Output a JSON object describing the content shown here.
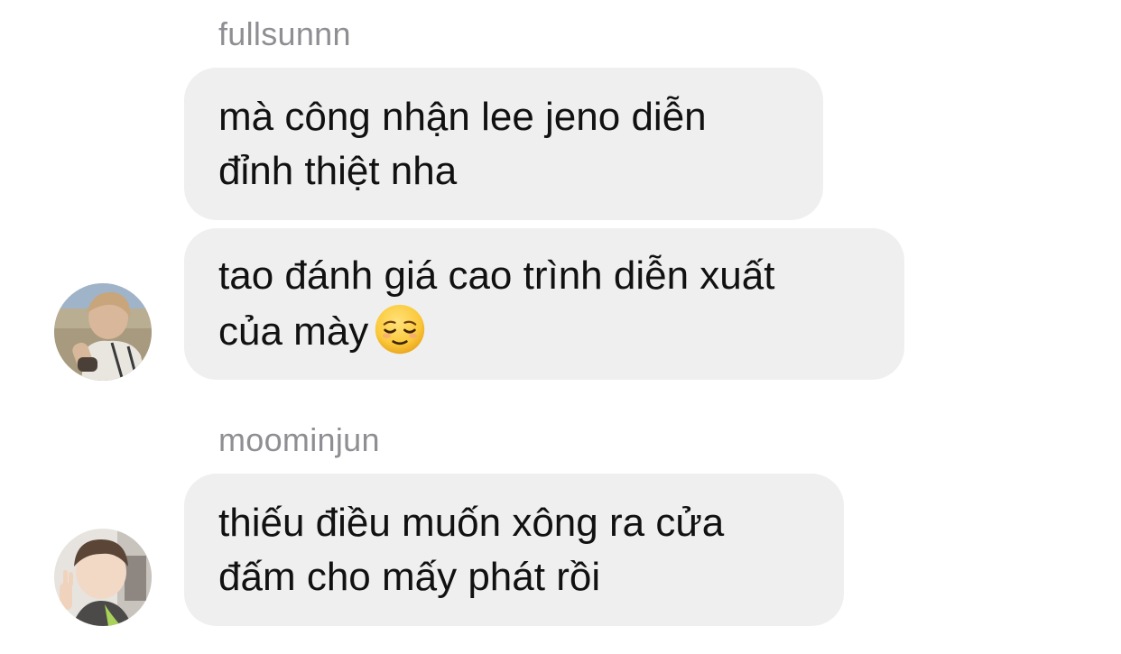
{
  "messages": {
    "group1": {
      "sender": "fullsunnn",
      "bubble1": "mà công nhận lee jeno diễn\nđỉnh thiệt nha",
      "bubble2": "tao đánh giá cao trình diễn xuất\ncủa mày",
      "bubble2_emoji": "relieved-face-emoji",
      "avatar_icon": "avatar-photo-icon"
    },
    "group2": {
      "sender": "moominjun",
      "bubble1": "thiếu điều muốn xông ra cửa\nđấm cho mấy phát rồi",
      "avatar_icon": "avatar-photo-icon"
    }
  },
  "colors": {
    "bubble_bg": "#efefef",
    "sender_name": "#8e8e93",
    "text": "#111111",
    "background": "#ffffff"
  }
}
